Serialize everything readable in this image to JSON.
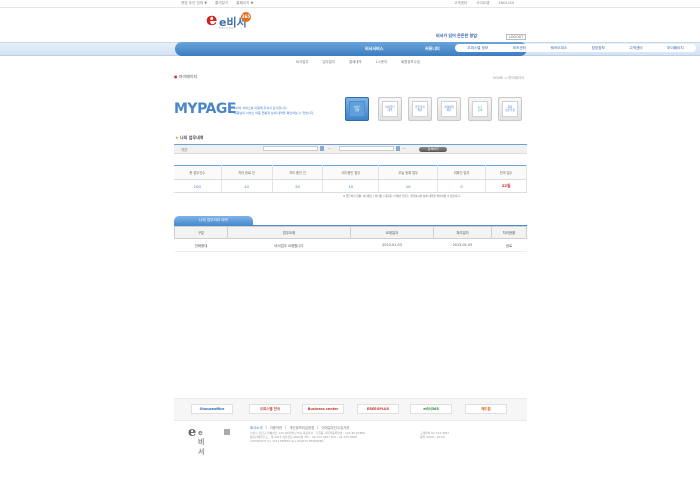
{
  "util": {
    "left": [
      "랜덤 추천 업체 ▼",
      "즐겨찾기",
      "홈페이지 ▼"
    ],
    "right": [
      "고객센터",
      "사이트맵",
      "ENGLISH"
    ]
  },
  "header": {
    "logo_text": "e비서",
    "logo_badge": "365",
    "logo_sub": "EBISEO",
    "slogan": "비서가 있어 든든한 창업",
    "logout_label": "LOGOUT"
  },
  "nav": {
    "primary": [
      "비서서비스",
      "커뮤니티"
    ],
    "items": [
      "오피스텔 정보",
      "비즈센터",
      "쉐어오피스",
      "창업정보",
      "고객센터",
      "마이페이지"
    ],
    "sub": [
      "비서업무",
      "업무일지",
      "결제내역",
      "1:1문의",
      "회원정보수정"
    ]
  },
  "breadcrumb": {
    "label": "마이페이지",
    "right": "HOME > 마이페이지"
  },
  "mypage": {
    "title": "MYPAGE",
    "desc": [
      "e비서 서비스를 이용해 주셔서 감사합니다.",
      "회원님의 서비스 이용 현황과 상세 내역을 확인하실 수 있습니다."
    ],
    "tiles": [
      "서비스\n현황",
      "비서업무\n내역",
      "업무일지\n확인",
      "결제내역\n확인",
      "1:1\n문의",
      "회원\n정보수정"
    ]
  },
  "section": {
    "title": "나의 업무내역"
  },
  "search": {
    "period_label": "기간",
    "tilde": "~",
    "button": "검색하기"
  },
  "stats": {
    "headers": [
      "총 업무건수",
      "처리 완료 건",
      "처리 중인 건",
      "대기중인 업무",
      "오늘 등록 업무",
      "미확인 업무",
      "잔여 일수"
    ],
    "values": [
      "100",
      "10",
      "20",
      "10",
      "10",
      "0",
      "22일"
    ]
  },
  "legend": "※ 업무처리 현황: 처리완료 / 처리중 / 대기중 / 미확인 업무는 클릭하시면 상세 내역을 확인하실 수 있습니다.",
  "list": {
    "tab": "나의 업무처리 이력",
    "headers": [
      "구분",
      "업무요청",
      "요청일자",
      "처리일자",
      "처리현황"
    ],
    "rows": [
      [
        "전화응대",
        "비서업무 요청합니다",
        "2013-01-03",
        "2013-01-05",
        "완료"
      ]
    ]
  },
  "partners": [
    {
      "name": "Ohouseoffice",
      "color": "#2b6fb8"
    },
    {
      "name": "오피스텔 천국",
      "color": "#c0392b"
    },
    {
      "name": "Business center",
      "color": "#c0392b"
    },
    {
      "name": "EREEOPLUS",
      "color": "#c0392b"
    },
    {
      "name": "e비서365",
      "color": "#2e8b3a"
    },
    {
      "name": "애드원",
      "color": "#d35400"
    }
  ],
  "footer": {
    "logo": "e비서",
    "links": [
      "회사소개",
      "이용약관",
      "개인정보취급방침",
      "이메일무단수집거부"
    ],
    "address": [
      "서울시 강남구 테헤란로 123 e비서빌딩 5층 대표이사 : 홍길동 사업자등록번호 : 123-45-67890",
      "통신판매업신고 : 제 2013-서울강남-0000호 TEL : 02-123-4567 FAX : 02-123-4568",
      "COPYRIGHT (C) 2013 EBISEO ALL RIGHTS RESERVED."
    ],
    "cs": [
      "고객센터 02-123-4567",
      "평일 09:00~18:00"
    ]
  }
}
